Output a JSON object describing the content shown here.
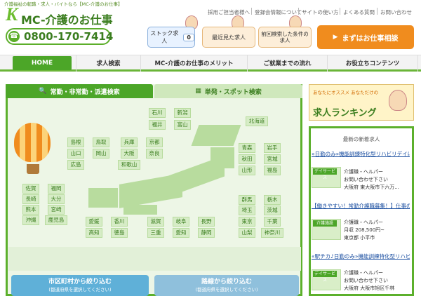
{
  "header": {
    "tagline": "介護福祉の転職・求人・バイトなら【MC-介護のお仕事】",
    "logo_mark": "K",
    "logo_text": "MC-介護のお仕事",
    "phone": "0800-170-7414",
    "util_links": [
      "採用ご担当者様へ",
      "登録会情報について",
      "サイトの使い方",
      "よくある質問",
      "お問い合わせ"
    ],
    "stock_label": "ストック求人",
    "stock_count": "0",
    "recent_label": "最近見た求人",
    "saved_search_label": "前回検索した条件の求人",
    "cta_label": "まずはお仕事相談"
  },
  "nav": {
    "items": [
      "HOME",
      "求人検索",
      "MC-介護のお仕事のメリット",
      "ご就業までの流れ",
      "お役立ちコンテンツ"
    ]
  },
  "search": {
    "tab_regular": "常勤・非常勤・派遣検索",
    "tab_spot": "単発・スポット検索",
    "prefectures": {
      "ishikawa": "石川",
      "niigata": "新潟",
      "fukui": "福井",
      "toyama": "富山",
      "hokkaido": "北海道",
      "shimane": "島根",
      "tottori": "鳥取",
      "hyogo": "兵庫",
      "kyoto": "京都",
      "yamaguchi": "山口",
      "okayama": "岡山",
      "osaka": "大阪",
      "nara": "奈良",
      "hiroshima": "広島",
      "wakayama": "和歌山",
      "aomori": "青森",
      "iwate": "岩手",
      "akita": "秋田",
      "miyagi": "宮城",
      "yamagata": "山形",
      "fukushima": "福島",
      "saga": "佐賀",
      "fukuoka": "福岡",
      "nagasaki": "長崎",
      "oita": "大分",
      "kumamoto": "熊本",
      "miyazaki": "宮崎",
      "okinawa": "沖縄",
      "kagoshima": "鹿児島",
      "ehime": "愛媛",
      "kagawa": "香川",
      "kochi": "高知",
      "tokushima": "徳島",
      "shiga": "滋賀",
      "gifu": "岐阜",
      "nagano": "長野",
      "mie": "三重",
      "aichi": "愛知",
      "shizuoka": "静岡",
      "gunma": "群馬",
      "tochigi": "栃木",
      "saitama": "埼玉",
      "ibaraki": "茨城",
      "tokyo": "東京",
      "chiba": "千葉",
      "yamanashi": "山梨",
      "kanagawa": "神奈川"
    },
    "city_btn": "市区町村から絞り込む",
    "city_btn_sub": "(都道府県を選択してください)",
    "line_btn": "路線から絞り込む",
    "line_btn_sub": "(都道府県を選択してください)"
  },
  "sidebar": {
    "ranking_small": "あなたにオススメ あなただけの",
    "ranking_title": "求人ランキング",
    "new_jobs_heading": "最新の新着求人",
    "jobs": [
      {
        "title": "«日勤のみ»機能訓練特化型リハビリデイにて介護職大募集♪送迎「駐車...",
        "tag": "デイサービス",
        "l1": "介護職・ヘルパー",
        "l2": "お問い合わせ下さい",
        "l3": "大阪府 東大阪市下六万..."
      },
      {
        "title": "【働きやすい！常勤介護職募集！】仕事の平準化を推し、職員が安心して...",
        "tag": "介護施設",
        "l1": "介護職・ヘルパー",
        "l2": "月収 208,500円~",
        "l3": "東京都 小平市"
      },
      {
        "title": "«駅チカ♪日勤のみ»機能訓練特化型リハビリデイにて介護職大募集♪送迎...",
        "tag": "デイサービス",
        "l1": "介護職・ヘルパー",
        "l2": "お問い合わせ下さい",
        "l3": "大阪府 大阪市旭区千林"
      }
    ]
  }
}
